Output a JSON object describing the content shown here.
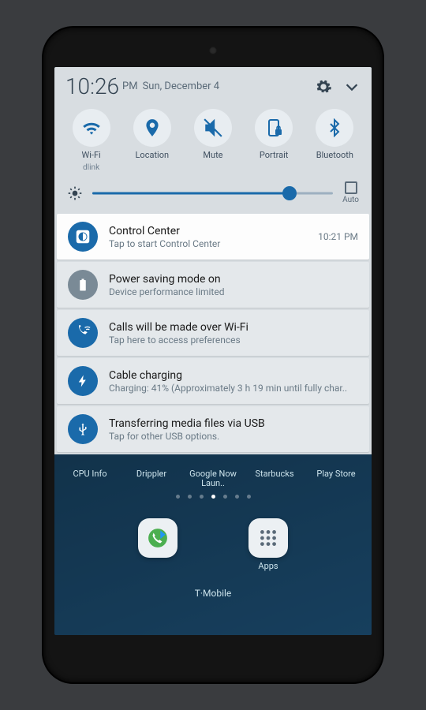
{
  "header": {
    "time": "10:26",
    "ampm": "PM",
    "date": "Sun, December 4"
  },
  "toggles": [
    {
      "name": "wifi",
      "label": "Wi-Fi",
      "sub": "dlink"
    },
    {
      "name": "location",
      "label": "Location",
      "sub": ""
    },
    {
      "name": "mute",
      "label": "Mute",
      "sub": ""
    },
    {
      "name": "portrait",
      "label": "Portrait",
      "sub": ""
    },
    {
      "name": "bluetooth",
      "label": "Bluetooth",
      "sub": ""
    }
  ],
  "brightness": {
    "auto_label": "Auto"
  },
  "notifications": [
    {
      "title": "Control Center",
      "sub": "Tap to start Control Center",
      "time": "10:21 PM",
      "icon": "cc",
      "color": "blue",
      "active": true
    },
    {
      "title": "Power saving mode on",
      "sub": "Device performance limited",
      "time": "",
      "icon": "power",
      "color": "grey",
      "active": false
    },
    {
      "title": "Calls will be made over Wi-Fi",
      "sub": "Tap here to access preferences",
      "time": "",
      "icon": "wificall",
      "color": "blue",
      "active": false
    },
    {
      "title": "Cable charging",
      "sub": "Charging: 41% (Approximately 3 h 19 min until fully char..",
      "time": "",
      "icon": "charge",
      "color": "blue",
      "active": false
    },
    {
      "title": "Transferring media files via USB",
      "sub": "Tap for other USB options.",
      "time": "",
      "icon": "usb",
      "color": "blue",
      "active": false
    }
  ],
  "app_labels": [
    "CPU Info",
    "Drippler",
    "Google Now Laun..",
    "Starbucks",
    "Play Store"
  ],
  "dock": {
    "apps_label": "Apps"
  },
  "carrier": "T·Mobile"
}
